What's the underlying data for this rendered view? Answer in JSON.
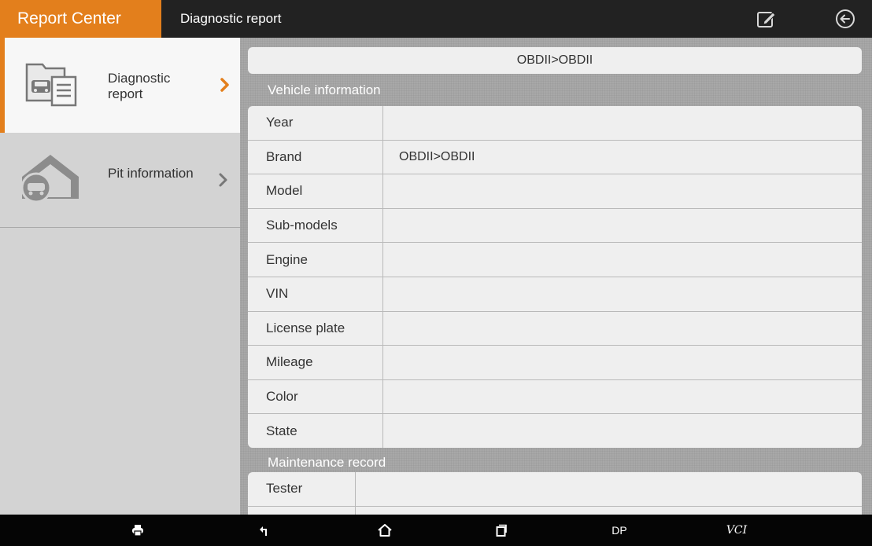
{
  "header": {
    "app_title": "Report Center",
    "page_title": "Diagnostic report",
    "accent_color": "#e37f1c"
  },
  "sidebar": {
    "items": [
      {
        "label": "Diagnostic report",
        "icon": "report-document-icon",
        "active": true
      },
      {
        "label": "Pit information",
        "icon": "garage-car-icon",
        "active": false
      }
    ]
  },
  "main": {
    "path": "OBDII>OBDII",
    "vehicle_section": {
      "title": "Vehicle information",
      "rows": [
        {
          "label": "Year",
          "value": ""
        },
        {
          "label": "Brand",
          "value": "OBDII>OBDII"
        },
        {
          "label": "Model",
          "value": ""
        },
        {
          "label": "Sub-models",
          "value": ""
        },
        {
          "label": "Engine",
          "value": ""
        },
        {
          "label": "VIN",
          "value": ""
        },
        {
          "label": "License plate",
          "value": ""
        },
        {
          "label": "Mileage",
          "value": ""
        },
        {
          "label": "Color",
          "value": ""
        },
        {
          "label": "State",
          "value": ""
        }
      ]
    },
    "maintenance_section": {
      "title": "Maintenance record",
      "rows": [
        {
          "label": "Tester",
          "value": ""
        }
      ]
    }
  },
  "navbar": {
    "items": [
      {
        "name": "printer-icon"
      },
      {
        "name": "back-arrow-icon"
      },
      {
        "name": "home-icon"
      },
      {
        "name": "recent-apps-icon"
      },
      {
        "label": "DP"
      },
      {
        "label": "VCI"
      }
    ]
  }
}
